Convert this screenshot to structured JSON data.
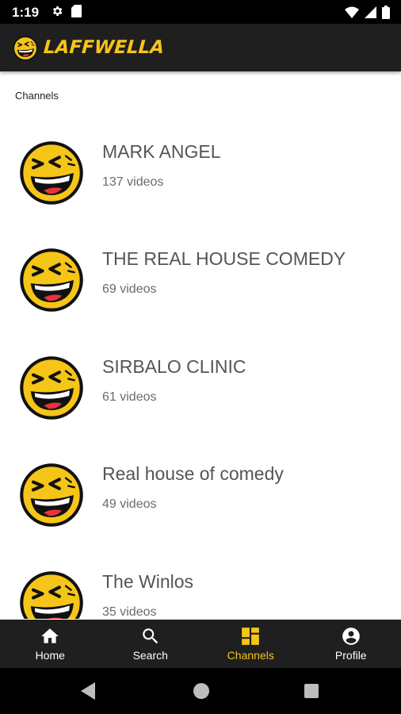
{
  "status_bar": {
    "time": "1:19",
    "left_icons": [
      "gear-icon",
      "sd-card-icon"
    ],
    "right_icons": [
      "wifi-icon",
      "signal-icon",
      "battery-icon"
    ]
  },
  "app_bar": {
    "logo_text": "LAFFWELLA",
    "logo_icon": "laughing-face-icon"
  },
  "section_label": "Channels",
  "channels": [
    {
      "name": "MARK ANGEL",
      "count": "137 videos"
    },
    {
      "name": "THE REAL HOUSE COMEDY",
      "count": "69 videos"
    },
    {
      "name": "SIRBALO CLINIC",
      "count": "61 videos"
    },
    {
      "name": "Real house of comedy",
      "count": "49 videos"
    },
    {
      "name": "The Winlos",
      "count": "35 videos"
    }
  ],
  "bottom_nav": {
    "items": [
      {
        "label": "Home",
        "icon": "home-icon"
      },
      {
        "label": "Search",
        "icon": "search-icon"
      },
      {
        "label": "Channels",
        "icon": "channels-icon",
        "active": true
      },
      {
        "label": "Profile",
        "icon": "profile-icon"
      }
    ]
  },
  "colors": {
    "accent": "#f5c518",
    "app_bar_bg": "#1f1f1f",
    "status_bar_bg": "#000000",
    "avatar_face": "#f5c518"
  }
}
